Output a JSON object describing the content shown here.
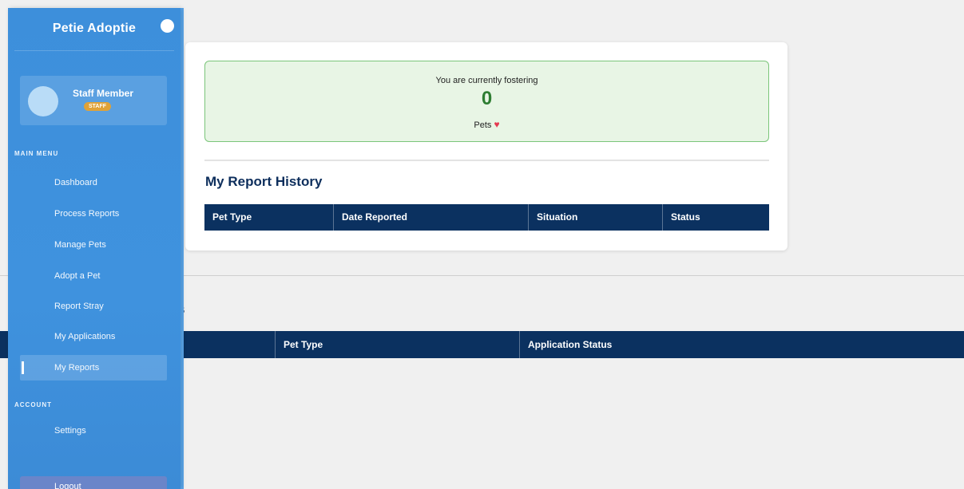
{
  "sidebar": {
    "brand": "Petie Adoptie",
    "profile": {
      "name": "Staff Member",
      "role": "STAFF"
    },
    "sections": {
      "main": "MAIN MENU",
      "account": "ACCOUNT"
    },
    "main_items": [
      {
        "label": "Dashboard"
      },
      {
        "label": "Process Reports"
      },
      {
        "label": "Manage Pets"
      },
      {
        "label": "Adopt a Pet"
      },
      {
        "label": "Report Stray"
      },
      {
        "label": "My Applications"
      },
      {
        "label": "My Reports",
        "active": true
      }
    ],
    "account_items": [
      {
        "label": "Settings"
      }
    ],
    "logout_label": "Logout"
  },
  "foster": {
    "text": "You are currently fostering",
    "count": "0",
    "unit": "Pets",
    "heart_icon": "heart-icon"
  },
  "report_history": {
    "title": "My Report History",
    "columns": [
      "Pet Type",
      "Date Reported",
      "Situation",
      "Status"
    ],
    "rows": []
  },
  "background_section": {
    "title_visible_fragment": "s",
    "columns": [
      "Pet Type",
      "Application Status"
    ]
  },
  "colors": {
    "sidebar": "#3d8fdb",
    "table_header": "#0b3160",
    "title": "#0d2e5c",
    "foster_bg": "#e8f5e5",
    "foster_count": "#2e7d32",
    "badge": "#e0a238"
  }
}
